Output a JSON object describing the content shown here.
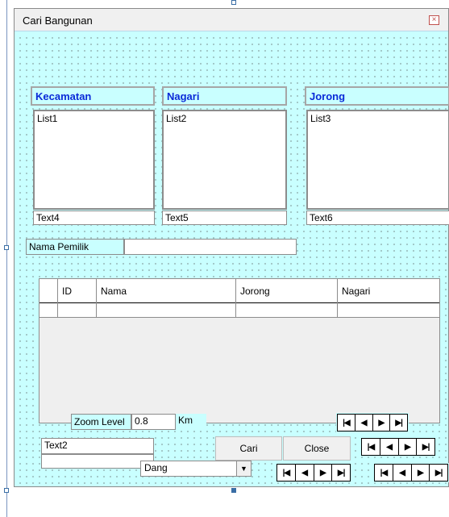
{
  "form": {
    "title": "Cari Bangunan",
    "close_glyph": "×"
  },
  "columns": [
    {
      "header": "Kecamatan",
      "list": "List1",
      "text": "Text4"
    },
    {
      "header": "Nagari",
      "list": "List2",
      "text": "Text5"
    },
    {
      "header": "Jorong",
      "list": "List3",
      "text": "Text6"
    }
  ],
  "owner": {
    "label": "Nama Pemilik",
    "value": ""
  },
  "grid": {
    "headers": [
      "ID",
      "Nama",
      "Jorong",
      "Nagari"
    ]
  },
  "zoom": {
    "label": "Zoom Level",
    "value": "0.8",
    "unit": "Km"
  },
  "search": {
    "text_value": "Text2"
  },
  "buttons": {
    "cari": "Cari",
    "close": "Close"
  },
  "combo": {
    "value": "Dang"
  },
  "nav": {
    "first": "|◀",
    "prev": "◀",
    "next": "▶",
    "last": "▶|"
  }
}
